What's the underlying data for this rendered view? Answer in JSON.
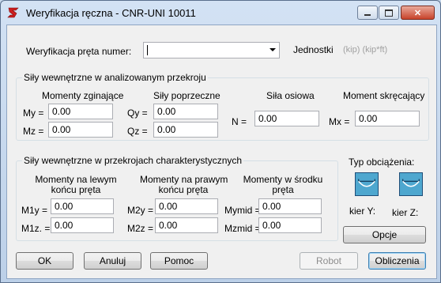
{
  "window": {
    "title": "Weryfikacja ręczna - CNR-UNI 10011"
  },
  "verification": {
    "label": "Weryfikacja pręta numer:",
    "value": ""
  },
  "units": {
    "label": "Jednostki",
    "value": "(kip) (kip*ft)"
  },
  "section_forces": {
    "title": "Siły wewnętrzne w analizowanym przekroju",
    "bending_header": "Momenty zginające",
    "shear_header": "Siły poprzeczne",
    "axial_header": "Siła osiowa",
    "torsion_header": "Moment skręcający",
    "my_label": "My =",
    "my_value": "0.00",
    "mz_label": "Mz =",
    "mz_value": "0.00",
    "qy_label": "Qy =",
    "qy_value": "0.00",
    "qz_label": "Qz =",
    "qz_value": "0.00",
    "n_label": "N =",
    "n_value": "0.00",
    "mx_label": "Mx =",
    "mx_value": "0.00"
  },
  "char_forces": {
    "title": "Siły wewnętrzne w przekrojach charakterystycznych",
    "left_header_1": "Momenty na lewym",
    "left_header_2": "końcu pręta",
    "right_header_1": "Momenty na prawym",
    "right_header_2": "końcu pręta",
    "mid_header_1": "Momenty w środku",
    "mid_header_2": "pręta",
    "m1y_label": "M1y =",
    "m1y_value": "0.00",
    "m1z_label": "M1z. =",
    "m1z_value": "0.00",
    "m2y_label": "M2y =",
    "m2y_value": "0.00",
    "m2z_label": "M2z =",
    "m2z_value": "0.00",
    "mymid_label": "Mymid =",
    "mymid_value": "0.00",
    "mzmid_label": "Mzmid =",
    "mzmid_value": "0.00"
  },
  "load_type": {
    "title": "Typ obciążenia:",
    "kier_y": "kier Y:",
    "kier_z": "kier Z:",
    "icon_y": "load-diagram-y-icon",
    "icon_z": "load-diagram-z-icon",
    "options_label": "Opcje"
  },
  "buttons": {
    "ok": "OK",
    "cancel": "Anuluj",
    "help": "Pomoc",
    "robot": "Robot",
    "calculate": "Obliczenia"
  },
  "colors": {
    "accent": "#3c7fb1",
    "icon_fill": "#4ea7cf",
    "app_icon": "#cc1f1f"
  }
}
